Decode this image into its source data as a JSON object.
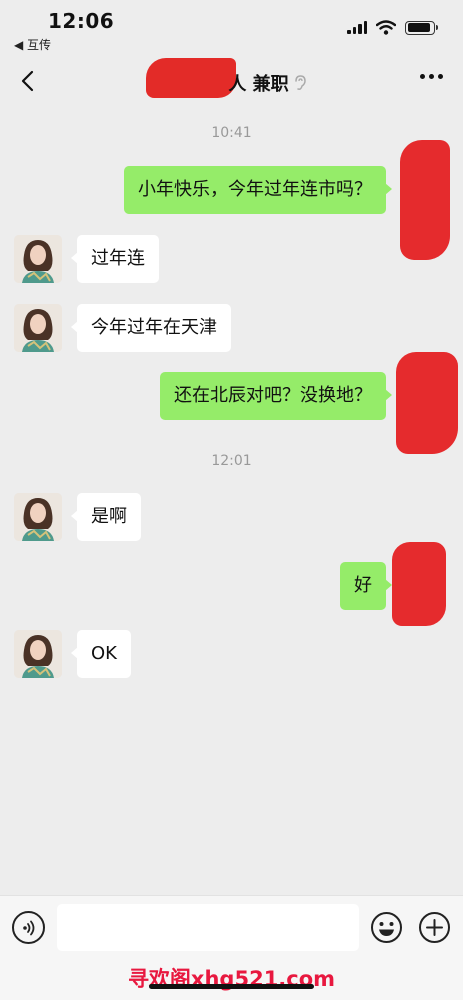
{
  "status": {
    "time": "12:06",
    "back_app": "◀ 互传"
  },
  "nav": {
    "title_suffix": "人 兼职"
  },
  "messages": [
    {
      "type": "time",
      "text": "10:41"
    },
    {
      "type": "out",
      "text": "小年快乐，今年过年连市吗？"
    },
    {
      "type": "in",
      "text": "过年连"
    },
    {
      "type": "in",
      "text": "今年过年在天津"
    },
    {
      "type": "out",
      "text": "还在北辰对吧？没换地？"
    },
    {
      "type": "time",
      "text": "12:01"
    },
    {
      "type": "in",
      "text": "是啊"
    },
    {
      "type": "out",
      "text": "好"
    },
    {
      "type": "in",
      "text": "OK"
    }
  ],
  "input": {
    "placeholder": ""
  },
  "watermark": "寻欢阁xhg521.com",
  "colors": {
    "outgoing_bubble": "#95ec69",
    "incoming_bubble": "#ffffff",
    "background": "#ededed",
    "redaction": "#e41a1c",
    "watermark": "#e8183f"
  },
  "icons": [
    "chevron-left-icon",
    "ear-icon",
    "more-icon",
    "voice-icon",
    "emoji-icon",
    "plus-icon",
    "wifi-icon",
    "signal-icon",
    "battery-icon"
  ]
}
